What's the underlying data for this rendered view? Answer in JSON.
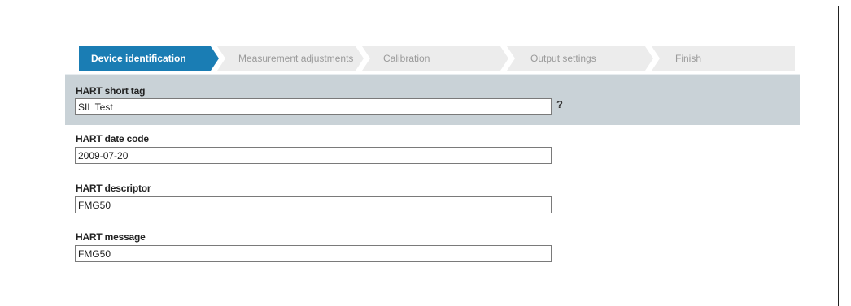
{
  "wizard": {
    "steps": [
      {
        "label": "Device identification",
        "active": true
      },
      {
        "label": "Measurement adjustments",
        "active": false
      },
      {
        "label": "Calibration",
        "active": false
      },
      {
        "label": "Output settings",
        "active": false
      },
      {
        "label": "Finish",
        "active": false
      }
    ]
  },
  "fields": {
    "short_tag": {
      "label": "HART short tag",
      "value": "SIL Test"
    },
    "date_code": {
      "label": "HART date code",
      "value": "2009-07-20"
    },
    "descriptor": {
      "label": "HART descriptor",
      "value": "FMG50"
    },
    "message": {
      "label": "HART message",
      "value": "FMG50"
    }
  },
  "help": {
    "symbol": "?"
  },
  "colors": {
    "active_step": "#1a7db4",
    "inactive_step": "#ececec",
    "highlight_band": "#c9d2d7"
  }
}
